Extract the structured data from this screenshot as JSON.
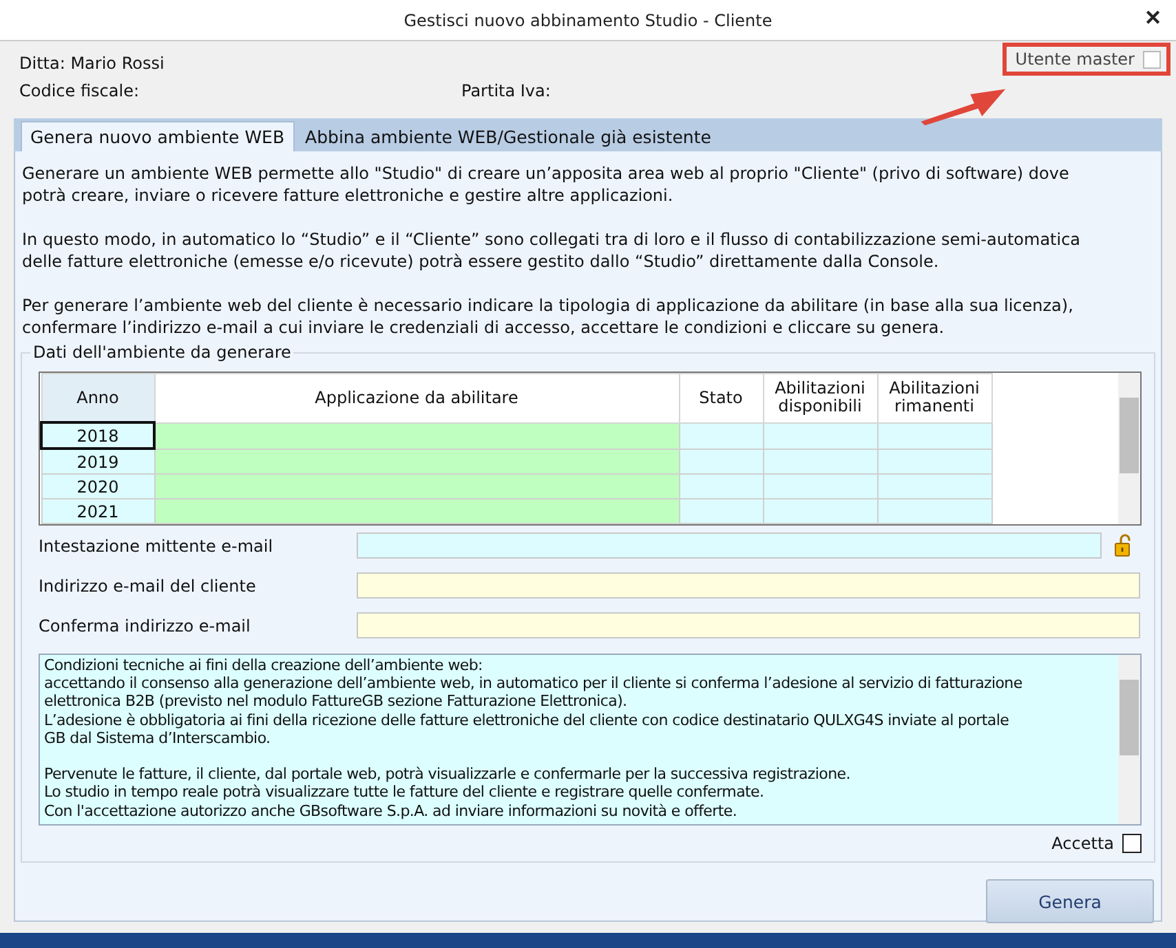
{
  "window": {
    "title": "Gestisci nuovo abbinamento Studio - Cliente",
    "close": "✕"
  },
  "header": {
    "ditta": "Ditta: Mario Rossi",
    "codice_fiscale": "Codice fiscale:",
    "partita_iva": "Partita Iva:",
    "master": {
      "label": "Utente master",
      "checked": false,
      "highlighted": true
    }
  },
  "tabs": [
    {
      "label": "Genera nuovo ambiente WEB",
      "selected": true
    },
    {
      "label": "Abbina ambiente WEB/Gestionale già esistente",
      "selected": false
    }
  ],
  "intro": [
    "Generare un ambiente WEB permette allo \"Studio\" di creare un’apposita area web al proprio \"Cliente\" (privo di software) dove potrà creare, inviare o ricevere fatture elettroniche e gestire altre applicazioni.",
    "In questo modo, in automatico lo “Studio” e il “Cliente” sono collegati tra di loro e il flusso di contabilizzazione semi-automatica delle fatture elettroniche (emesse e/o ricevute) potrà essere gestito dallo “Studio” direttamente dalla Console.",
    "Per generare l’ambiente web del cliente è necessario indicare la tipologia di applicazione da abilitare (in base alla sua licenza), confermare l’indirizzo e-mail a cui inviare le credenziali di accesso, accettare le condizioni e cliccare su genera."
  ],
  "group": {
    "title": "Dati dell'ambiente da generare",
    "grid": {
      "columns": [
        "Anno",
        "Applicazione da abilitare",
        "Stato",
        "Abilitazioni disponibili",
        "Abilitazioni rimanenti"
      ],
      "rows": [
        {
          "anno": "2018",
          "selected": true
        },
        {
          "anno": "2019",
          "selected": false
        },
        {
          "anno": "2020",
          "selected": false
        },
        {
          "anno": "2021",
          "selected": false
        }
      ]
    },
    "fields": [
      {
        "label": "Intestazione mittente e-mail",
        "kind": "locked"
      },
      {
        "label": "Indirizzo e-mail del cliente",
        "kind": "required"
      },
      {
        "label": "Conferma indirizzo e-mail",
        "kind": "required"
      }
    ],
    "conditions": [
      [
        "Condizioni tecniche ai fini della creazione dell’ambiente web:",
        "accettando il consenso alla generazione dell’ambiente web, in automatico per il cliente si conferma l’adesione al servizio di fatturazione",
        "elettronica B2B (previsto nel modulo FattureGB sezione Fatturazione Elettronica).",
        "L’adesione è obbligatoria ai fini della ricezione delle fatture elettroniche del cliente con codice destinatario QULXG4S inviate al portale",
        "GB dal Sistema d’Interscambio."
      ],
      [
        "Pervenute le fatture, il cliente, dal portale web, potrà visualizzarle e confermarle per la successiva registrazione.",
        "Lo studio in tempo reale potrà visualizzare tutte le fatture del cliente e registrare quelle confermate.",
        "Con l'accettazione autorizzo anche GBsoftware S.p.A. ad inviare informazioni su novità e offerte."
      ]
    ],
    "accept": {
      "label": "Accetta",
      "checked": false
    }
  },
  "buttons": [
    "Genera"
  ]
}
